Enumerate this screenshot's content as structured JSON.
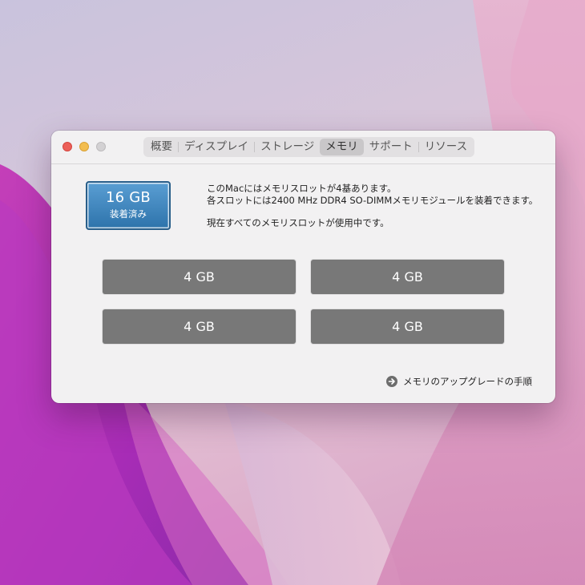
{
  "window": {
    "tabs": [
      {
        "label": "概要"
      },
      {
        "label": "ディスプレイ"
      },
      {
        "label": "ストレージ"
      },
      {
        "label": "メモリ"
      },
      {
        "label": "サポート"
      },
      {
        "label": "リソース"
      }
    ],
    "active_tab": "メモリ"
  },
  "memory": {
    "total": "16 GB",
    "status": "装着済み",
    "info_line1": "このMacにはメモリスロットが4基あります。",
    "info_line2": "各スロットには2400 MHz DDR4 SO-DIMMメモリモジュールを装着できます。",
    "info_line3": "現在すべてのメモリスロットが使用中です。",
    "slots": [
      {
        "label": "4 GB"
      },
      {
        "label": "4 GB"
      },
      {
        "label": "4 GB"
      },
      {
        "label": "4 GB"
      }
    ],
    "upgrade_link": "メモリのアップグレードの手順"
  },
  "icons": {
    "close": "close-icon",
    "minimize": "minimize-icon",
    "zoom": "zoom-icon",
    "upgrade": "arrow-right-circle-icon"
  },
  "colors": {
    "close": "#ec5f58",
    "minimize": "#f3bd4f",
    "badge": "#3b82bd",
    "slot": "#787878"
  }
}
